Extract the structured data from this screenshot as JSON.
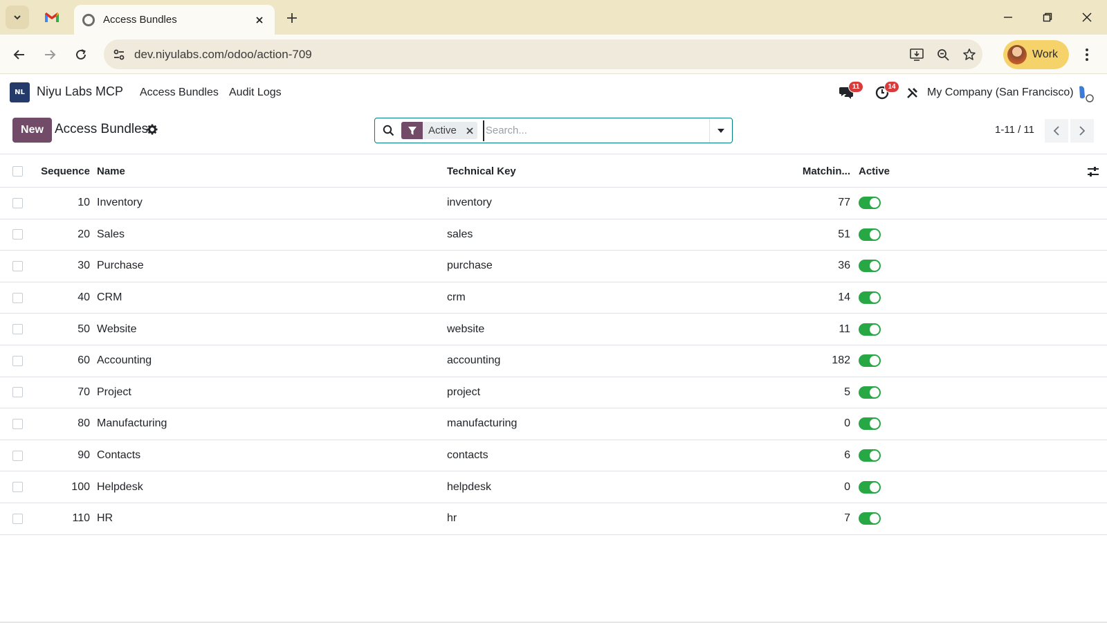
{
  "browser": {
    "tabs": [
      {
        "title": "",
        "icon": "gmail-icon"
      },
      {
        "title": "Access Bundles",
        "icon": "odoo-favicon",
        "active": true
      }
    ],
    "url": "dev.niyulabs.com/odoo/action-709",
    "profile_label": "Work"
  },
  "navbar": {
    "app_name": "Niyu Labs MCP",
    "logo_text": "NL",
    "menu": [
      "Access Bundles",
      "Audit Logs"
    ],
    "messages_count": "11",
    "activities_count": "14",
    "company": "My Company (San Francisco)"
  },
  "control_panel": {
    "new_label": "New",
    "title": "Access Bundles",
    "facet_label": "Active",
    "search_placeholder": "Search...",
    "pager": "1-11 / 11"
  },
  "list": {
    "columns": {
      "sequence": "Sequence",
      "name": "Name",
      "technical_key": "Technical Key",
      "matching": "Matchin...",
      "active": "Active"
    },
    "rows": [
      {
        "sequence": "10",
        "name": "Inventory",
        "key": "inventory",
        "matching": "77",
        "active": true
      },
      {
        "sequence": "20",
        "name": "Sales",
        "key": "sales",
        "matching": "51",
        "active": true
      },
      {
        "sequence": "30",
        "name": "Purchase",
        "key": "purchase",
        "matching": "36",
        "active": true
      },
      {
        "sequence": "40",
        "name": "CRM",
        "key": "crm",
        "matching": "14",
        "active": true
      },
      {
        "sequence": "50",
        "name": "Website",
        "key": "website",
        "matching": "11",
        "active": true
      },
      {
        "sequence": "60",
        "name": "Accounting",
        "key": "accounting",
        "matching": "182",
        "active": true
      },
      {
        "sequence": "70",
        "name": "Project",
        "key": "project",
        "matching": "5",
        "active": true
      },
      {
        "sequence": "80",
        "name": "Manufacturing",
        "key": "manufacturing",
        "matching": "0",
        "active": true
      },
      {
        "sequence": "90",
        "name": "Contacts",
        "key": "contacts",
        "matching": "6",
        "active": true
      },
      {
        "sequence": "100",
        "name": "Helpdesk",
        "key": "helpdesk",
        "matching": "0",
        "active": true
      },
      {
        "sequence": "110",
        "name": "HR",
        "key": "hr",
        "matching": "7",
        "active": true
      }
    ]
  },
  "colors": {
    "brand": "#714b67",
    "toggle_on": "#28a745",
    "badge": "#d93a3a",
    "browser_bar": "#efe6c6"
  }
}
